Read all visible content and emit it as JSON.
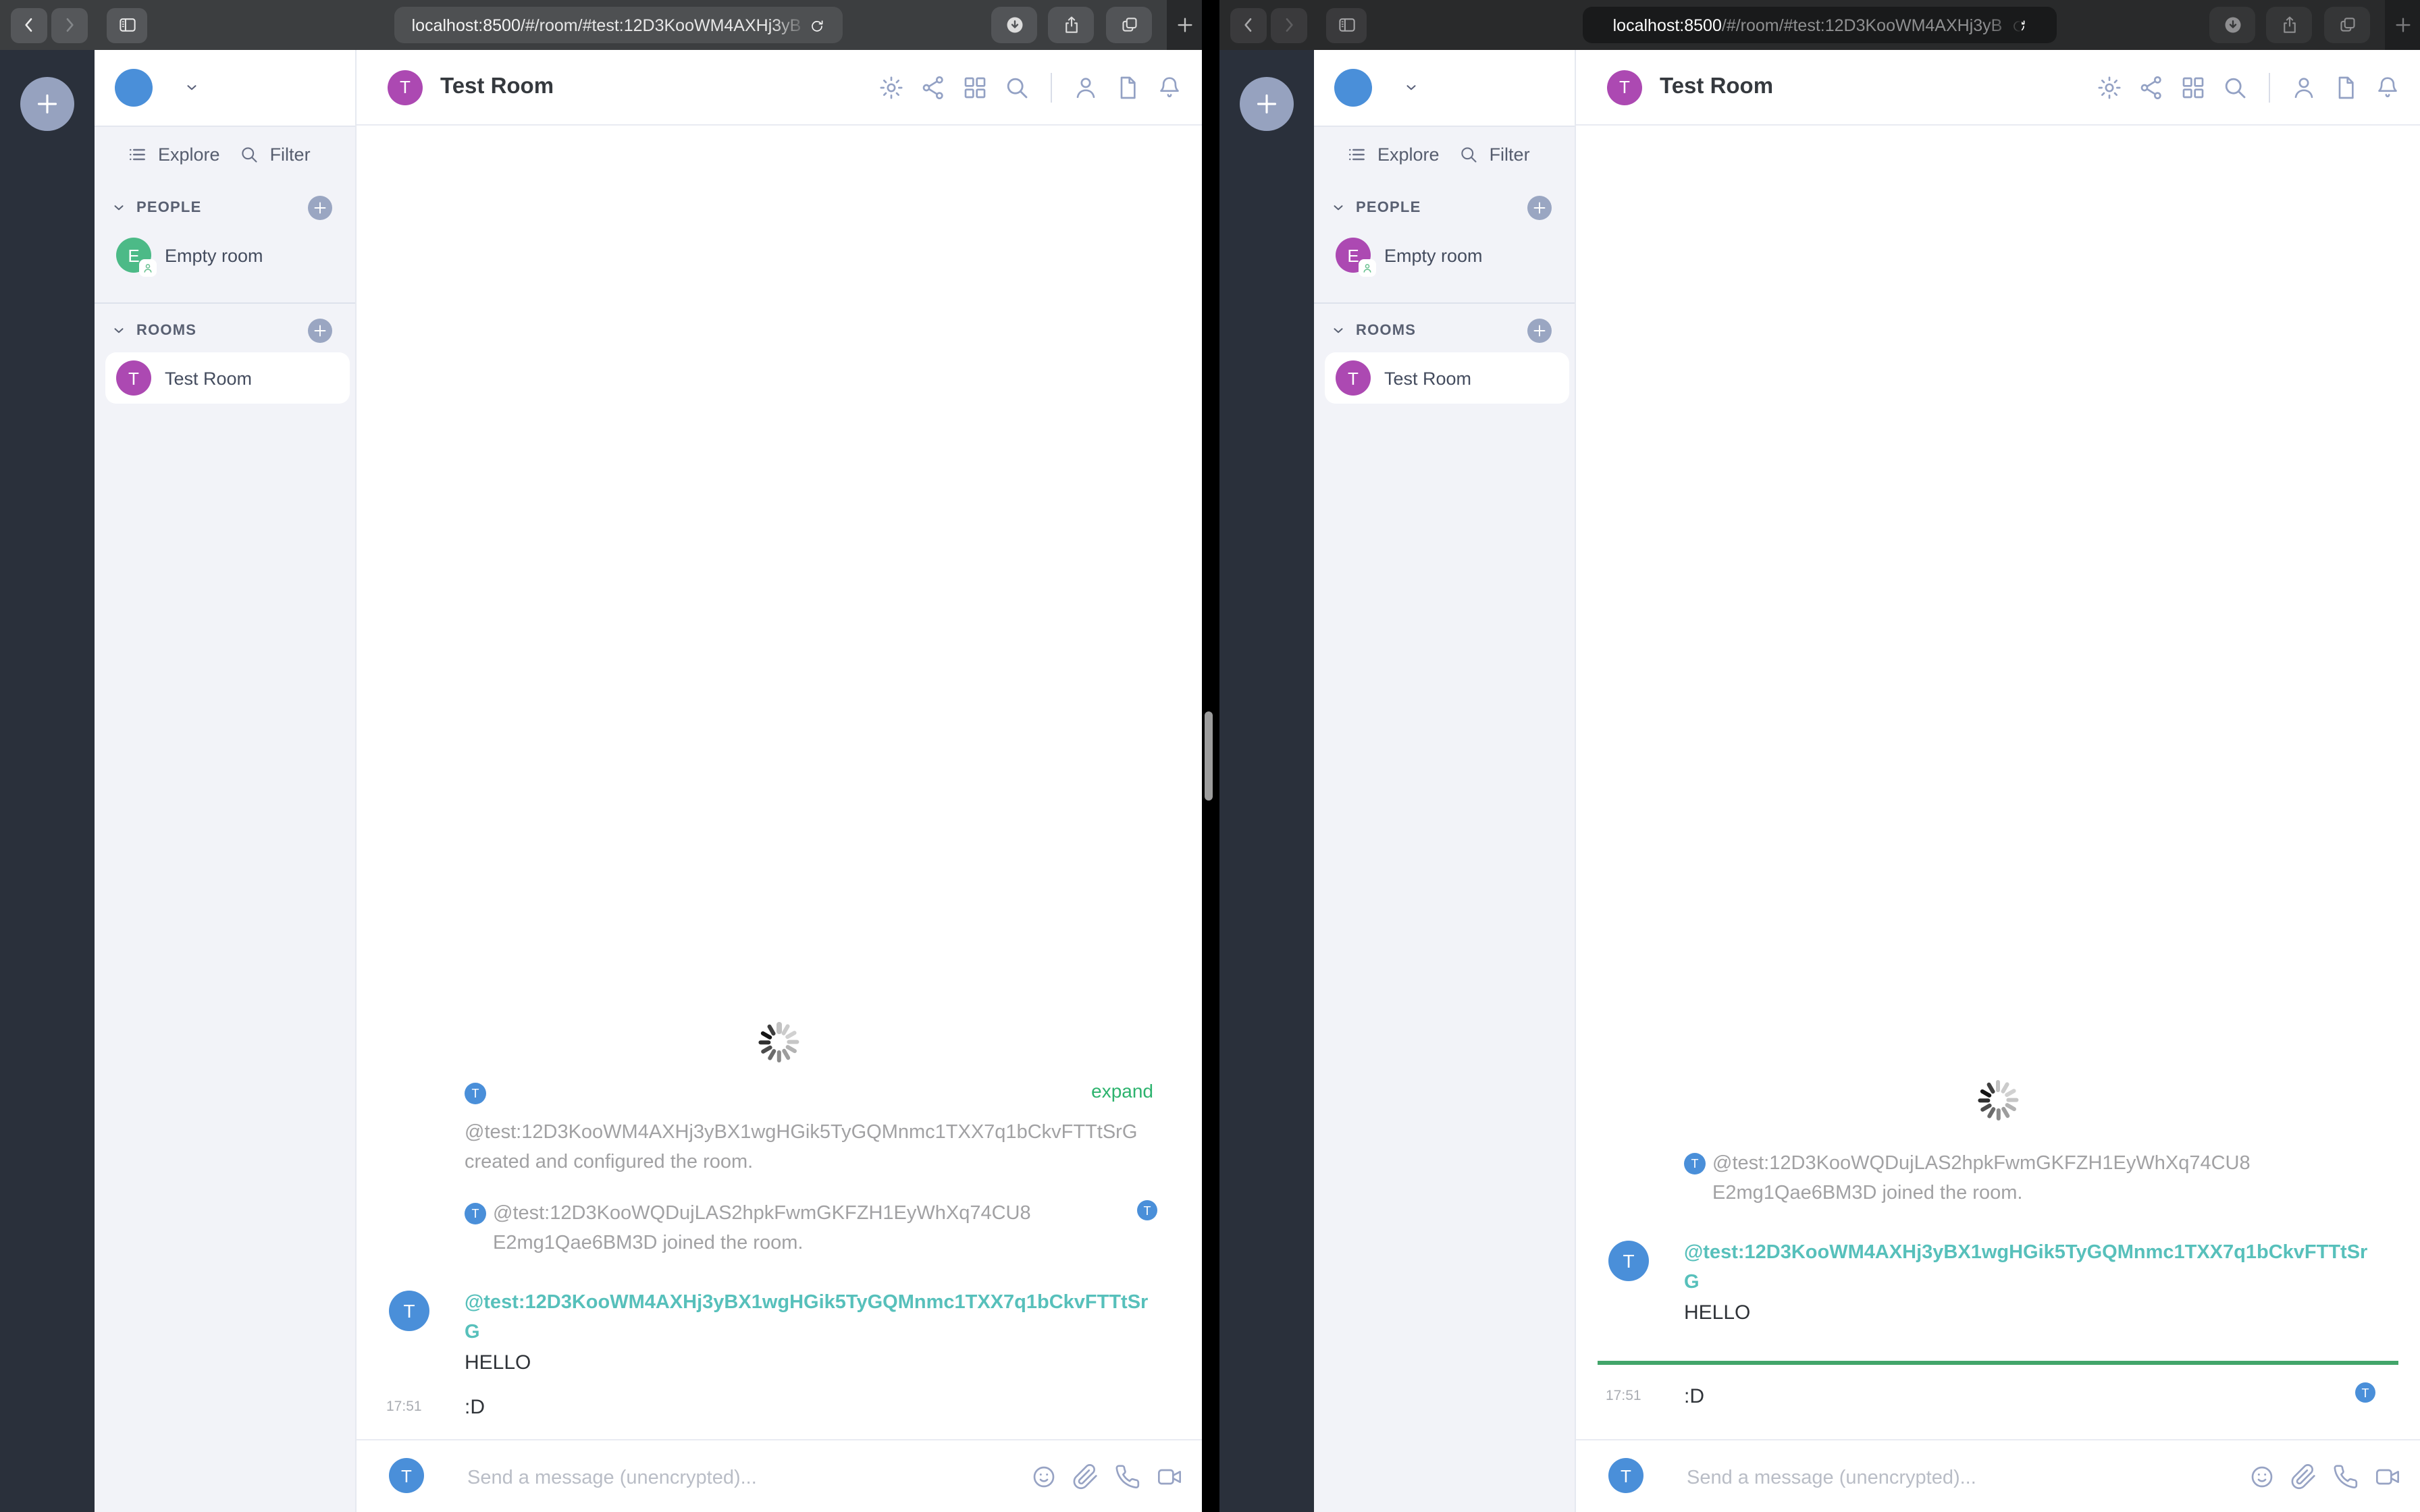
{
  "chrome": {
    "url_host": "localhost:8500",
    "url_path": "/#/room/#test:12D3KooWM4AXHj3yB",
    "icons": [
      "back-chevron",
      "forward-chevron",
      "sidebar-toggle",
      "reload",
      "download-circle",
      "share-square",
      "tab-copy",
      "new-tab-plus"
    ]
  },
  "sidebar": {
    "explore_label": "Explore",
    "filter_label": "Filter",
    "people_label": "PEOPLE",
    "rooms_label": "ROOMS",
    "empty_room_label": "Empty room",
    "test_room_label": "Test Room"
  },
  "header": {
    "title": "Test Room",
    "icons": [
      "settings-gear",
      "share-network",
      "apps-grid",
      "search-magnifier",
      "members-person",
      "files-document",
      "notifications-bell"
    ]
  },
  "timeline": {
    "expand_link": "expand",
    "creator_id": "@test:12D3KooWM4AXHj3yBX1wgHGik5TyGQMnmc1TXX7q1bCkvFTTtSrG",
    "created_text": "created and configured the room.",
    "joiner_id": "@test:12D3KooWQDujLAS2hpkFwmGKFZH1EyWhXq74CU8",
    "joiner_tail": "E2mg1Qae6BM3D joined the room.",
    "sender_id": "@test:12D3KooWM4AXHj3yBX1wgHGik5TyGQMnmc1TXX7q1bCkvFTTtSrG",
    "message_hello": "HELLO",
    "message_emote": ":D",
    "timestamp": "17:51"
  },
  "composer": {
    "placeholder": "Send a message (unencrypted)...",
    "icons": [
      "emoji-smiley",
      "attachment-paperclip",
      "voice-call-phone",
      "video-call-camera"
    ]
  },
  "avatars": {
    "room_letter": "T",
    "empty_room_letter": "E"
  },
  "colors": {
    "accent_green_expand": "#2db36e",
    "unread_marker_green": "#42a56a",
    "username_teal": "#57c0bb",
    "avatar_blue": "#4a8fd9",
    "avatar_magenta": "#ac49b2",
    "avatar_green_left": "#4cba87",
    "rail_bg": "#2a303b",
    "sidebar_bg": "#f2f3f8",
    "muted_icon_blue": "#93a1c4",
    "toolbar_left": "#3c3e40",
    "toolbar_right": "#292a2b"
  }
}
